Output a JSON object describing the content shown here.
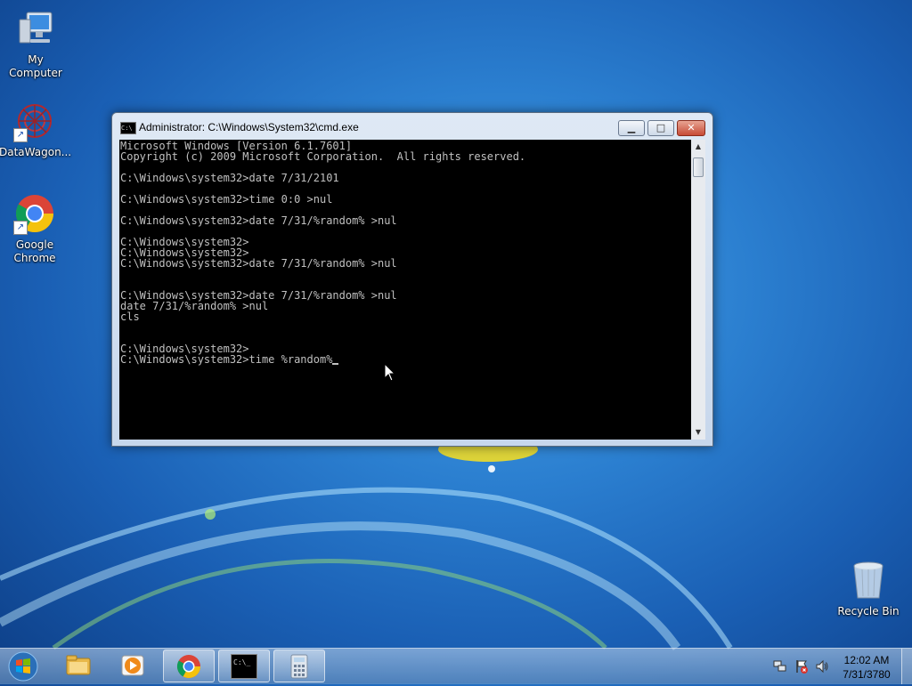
{
  "desktop": {
    "icons": [
      {
        "label": "My Computer"
      },
      {
        "label": "DataWagon..."
      },
      {
        "label": "Google Chrome"
      }
    ],
    "recycle_bin": {
      "label": "Recycle Bin"
    }
  },
  "cmd_window": {
    "title": "Administrator: C:\\Windows\\System32\\cmd.exe",
    "title_icon_text": "C:\\",
    "buttons": {
      "minimize": "▁",
      "maximize": "□",
      "close": "✕"
    },
    "console_lines": [
      "Microsoft Windows [Version 6.1.7601]",
      "Copyright (c) 2009 Microsoft Corporation.  All rights reserved.",
      "",
      "C:\\Windows\\system32>date 7/31/2101",
      "",
      "C:\\Windows\\system32>time 0:0 >nul",
      "",
      "C:\\Windows\\system32>date 7/31/%random% >nul",
      "",
      "C:\\Windows\\system32>",
      "C:\\Windows\\system32>",
      "C:\\Windows\\system32>date 7/31/%random% >nul",
      "",
      "",
      "C:\\Windows\\system32>date 7/31/%random% >nul",
      "date 7/31/%random% >nul",
      "cls",
      "",
      "",
      "C:\\Windows\\system32>",
      "C:\\Windows\\system32>time %random%"
    ]
  },
  "taskbar": {
    "items": [
      {
        "name": "start"
      },
      {
        "name": "windows-explorer"
      },
      {
        "name": "media-player"
      },
      {
        "name": "google-chrome"
      },
      {
        "name": "command-prompt",
        "icon_text": "C:\\_"
      },
      {
        "name": "calculator"
      }
    ],
    "clock": {
      "time": "12:02 AM",
      "date": "7/31/3780"
    }
  },
  "colors": {
    "console_bg": "#000000",
    "console_fg": "#c0c0c0",
    "desktop_accent": "#1a5fb4"
  }
}
